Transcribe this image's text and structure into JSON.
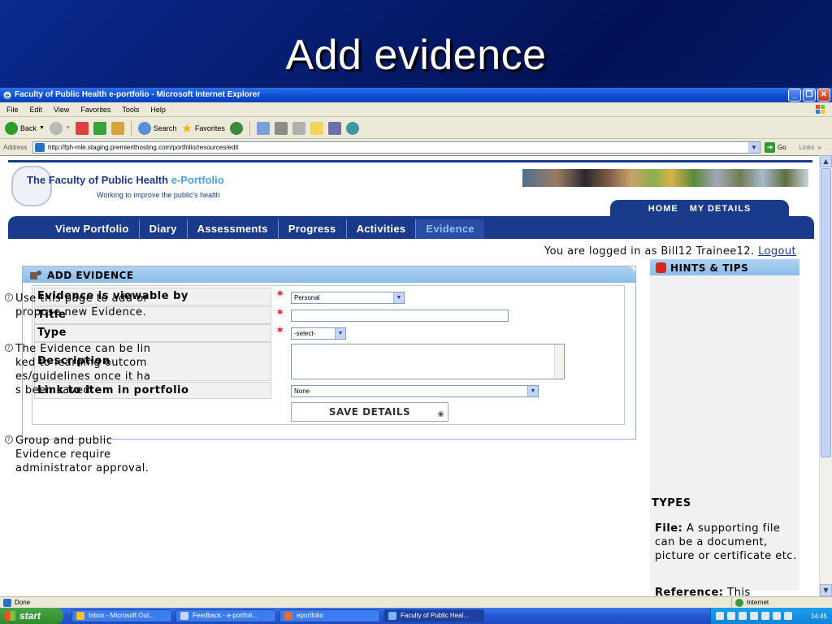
{
  "slide": {
    "title": "Add evidence"
  },
  "window": {
    "title": "Faculty of Public Health e-portfolio - Microsoft Internet Explorer",
    "menu": [
      "File",
      "Edit",
      "View",
      "Favorites",
      "Tools",
      "Help"
    ],
    "toolbar": {
      "back": "Back",
      "search": "Search",
      "favorites": "Favorites"
    },
    "address": {
      "label": "Address",
      "url": "http://fph-mle.staging.premierithosting.com/portfolio/resources/edit",
      "go": "Go",
      "links": "Links"
    },
    "status": {
      "left": "Done",
      "zone": "Internet"
    }
  },
  "site": {
    "brand": "The Faculty of Public Health",
    "brand_accent": "e-Portfolio",
    "tagline": "Working to improve the public's health",
    "top_tabs": [
      "HOME",
      "MY DETAILS"
    ],
    "nav": [
      "View Portfolio",
      "Diary",
      "Assessments",
      "Progress",
      "Activities",
      "Evidence"
    ],
    "login": {
      "text": "You are logged in as Bill12 Trainee12.",
      "logout": "Logout"
    },
    "colors": {
      "navy": "#1a3a8c",
      "accent": "#8ec0ff",
      "required": "#d01010"
    }
  },
  "form": {
    "title": "ADD EVIDENCE",
    "fields": {
      "viewable": {
        "label": "Evidence is viewable by",
        "value": "Personal"
      },
      "title": {
        "label": "Title",
        "value": ""
      },
      "type": {
        "label": "Type",
        "value": "-select-"
      },
      "description": {
        "label": "Description",
        "value": ""
      },
      "link": {
        "label": "Link to item in portfolio",
        "value": "None"
      }
    },
    "required_mark": "*",
    "save_label": "SAVE DETAILS"
  },
  "hints": {
    "title": "HINTS & TIPS",
    "items": [
      "Use this page to add or propose new Evidence.",
      "The Evidence can be linked to learning outcomes/guidelines once it has been saved.",
      "Group and public Evidence require administrator approval."
    ],
    "types_title": "TYPES",
    "types": [
      {
        "name": "File:",
        "desc": "A supporting file can be a document, picture or certificate etc."
      },
      {
        "name": "Reference:",
        "desc": "This"
      }
    ]
  },
  "taskbar": {
    "start": "start",
    "tasks": [
      "Inbox - Microsoft Out...",
      "Feedback - e-portfoli...",
      "eportfolio",
      "Faculty of Public Heal..."
    ],
    "time": "14:45"
  }
}
